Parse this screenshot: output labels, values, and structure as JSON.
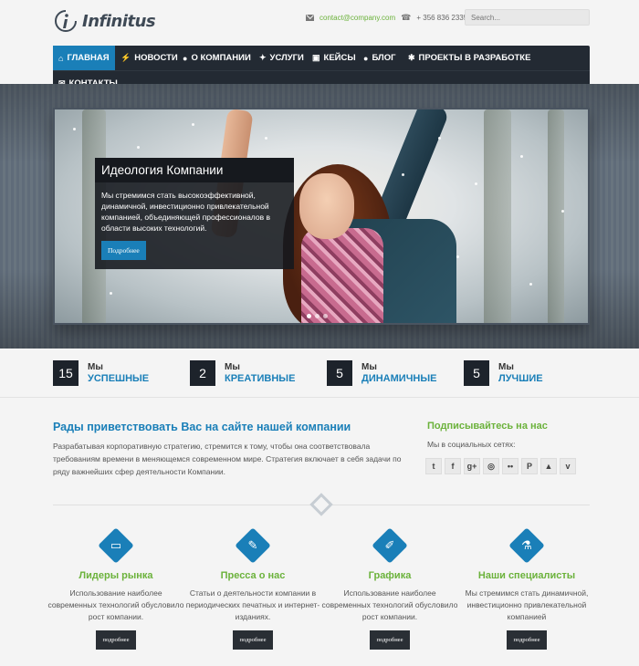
{
  "header": {
    "logo_text": "Infinitus",
    "email": "contact@company.com",
    "phone": "+ 356 836 2335",
    "search_placeholder": "Search..."
  },
  "nav": {
    "items": [
      {
        "label": "Главная",
        "icon": "home-icon",
        "glyph": "⌂"
      },
      {
        "label": "Новости",
        "icon": "bolt-icon",
        "glyph": "⚡"
      },
      {
        "label": "О компании",
        "icon": "user-icon",
        "glyph": "●"
      },
      {
        "label": "Услуги",
        "icon": "lightbulb-icon",
        "glyph": "✦"
      },
      {
        "label": "Кейсы",
        "icon": "briefcase-icon",
        "glyph": "▣"
      },
      {
        "label": "Блог",
        "icon": "comments-icon",
        "glyph": "●"
      },
      {
        "label": "Проекты в разработке",
        "icon": "gear-icon",
        "glyph": "✱"
      },
      {
        "label": "Контакты",
        "icon": "envelope-icon",
        "glyph": "✉"
      }
    ]
  },
  "slider": {
    "title": "Идеология Компании",
    "text": "Мы стремимся стать высокоэффективной, динамичной, инвестиционно привлекательной компанией, объединяющей профессионалов в области высоких технологий.",
    "button": "Подробнее",
    "slides_count": 3,
    "active_slide": 1
  },
  "stats": [
    {
      "num": "15",
      "top": "Мы",
      "bottom": "Успешные"
    },
    {
      "num": "2",
      "top": "Мы",
      "bottom": "Креативные"
    },
    {
      "num": "5",
      "top": "Мы",
      "bottom": "Динамичные"
    },
    {
      "num": "5",
      "top": "Мы",
      "bottom": "Лучшие"
    }
  ],
  "welcome": {
    "title": "Рады приветствовать Вас на сайте нашей компании",
    "text": "Разрабатывая корпоративную стратегию, стремится к тому, чтобы она соответствовала требованиям времени в меняющемся современном мире. Стратегия включает в себя задачи по ряду важнейших сфер деятельности Компании."
  },
  "follow": {
    "title": "Подписывайтесь на нас",
    "subtitle": "Мы в социальных сетях:",
    "networks": [
      {
        "name": "twitter-icon",
        "glyph": "t"
      },
      {
        "name": "facebook-icon",
        "glyph": "f"
      },
      {
        "name": "google-plus-icon",
        "glyph": "g+"
      },
      {
        "name": "dribbble-icon",
        "glyph": "◎"
      },
      {
        "name": "flickr-icon",
        "glyph": "••"
      },
      {
        "name": "pinterest-icon",
        "glyph": "P"
      },
      {
        "name": "forrst-icon",
        "glyph": "▲"
      },
      {
        "name": "vimeo-icon",
        "glyph": "v"
      }
    ]
  },
  "features": [
    {
      "icon": "monitor-icon",
      "glyph": "▭",
      "title": "Лидеры рынка",
      "text": "Использование наиболее современных технологий обусловило рост компании.",
      "button": "подробнее"
    },
    {
      "icon": "pencil-icon",
      "glyph": "✎",
      "title": "Пресса о нас",
      "text": "Статьи о деятельности компании в периодических печатных и интернет-изданиях.",
      "button": "подробнее"
    },
    {
      "icon": "brush-icon",
      "glyph": "✐",
      "title": "Графика",
      "text": "Использование наиболее современных технологий обусловило рост компании.",
      "button": "подробнее"
    },
    {
      "icon": "flask-icon",
      "glyph": "⚗",
      "title": "Наши специалисты",
      "text": "Мы стремимся стать динамичной, инвестиционно привлекательной компанией",
      "button": "подробнее"
    }
  ],
  "colors": {
    "accent": "#1a7fb8",
    "green": "#6bb23b",
    "dark": "#232a33"
  }
}
